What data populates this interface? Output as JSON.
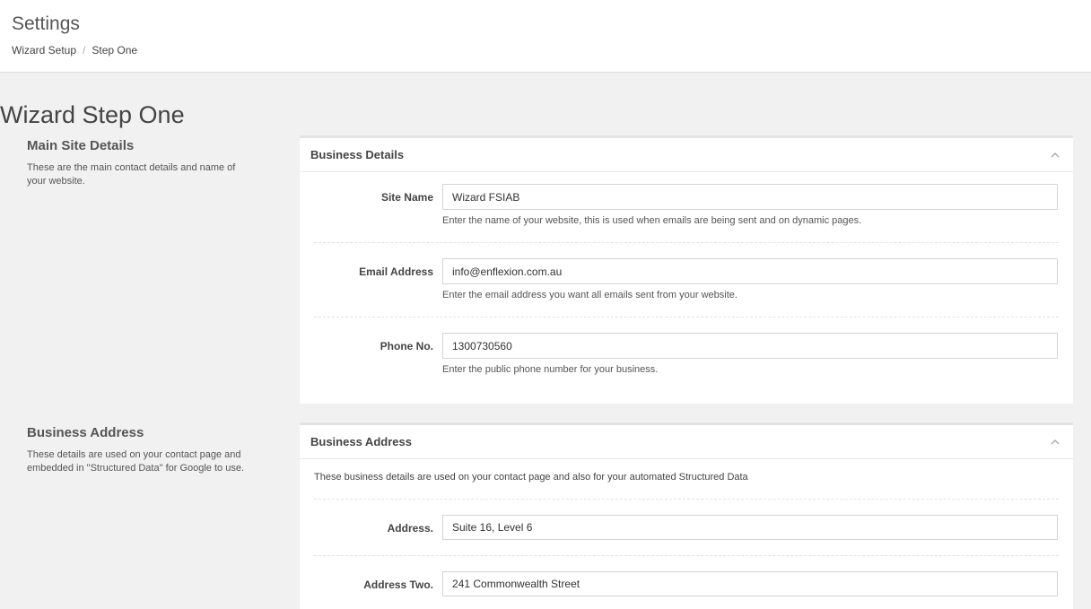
{
  "header": {
    "title": "Settings",
    "breadcrumb": [
      {
        "label": "Wizard Setup"
      },
      {
        "label": "Step One"
      }
    ]
  },
  "page": {
    "title": "Wizard Step One"
  },
  "sections": {
    "main": {
      "title": "Main Site Details",
      "description": "These are the main contact details and name of your website."
    },
    "address": {
      "title": "Business Address",
      "description": "These details are used on your contact page and embedded in \"Structured Data\" for Google to use."
    }
  },
  "business_details": {
    "panel_title": "Business Details",
    "fields": {
      "site_name": {
        "label": "Site Name",
        "value": "Wizard FSIAB",
        "help": "Enter the name of your website, this is used when emails are being sent and on dynamic pages."
      },
      "email": {
        "label": "Email Address",
        "value": "info@enflexion.com.au",
        "help": "Enter the email address you want all emails sent from your website."
      },
      "phone": {
        "label": "Phone No.",
        "value": "1300730560",
        "help": "Enter the public phone number for your business."
      }
    }
  },
  "business_address": {
    "panel_title": "Business Address",
    "intro": "These business details are used on your contact page and also for your automated Structured Data",
    "fields": {
      "address": {
        "label": "Address.",
        "value": "Suite 16, Level 6"
      },
      "address_two": {
        "label": "Address Two.",
        "value": "241 Commonwealth Street"
      }
    }
  },
  "icons": {
    "collapse": "chevron-up-icon"
  }
}
